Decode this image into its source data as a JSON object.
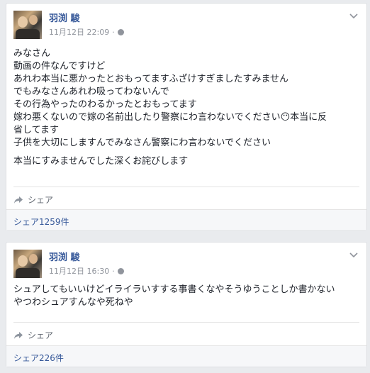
{
  "posts": [
    {
      "author": "羽渕 駿",
      "timestamp": "11月12日 22:09",
      "visibility_sep": "·",
      "body_lines": [
        "みなさん",
        "動画の件なんですけど",
        "あれわ本当に悪かったとおもってますふざけすぎましたすみません",
        "でもみなさんあれわ吸ってわないんで",
        "その行為やったのわるかったとおもってます",
        "嫁わ悪くないので嫁の名前出したり警察にわ言わないでください😶本当に反",
        "省してます",
        "子供を大切にしますんでみなさん警察にわ言わないでください"
      ],
      "body_tail": "本当にすみませんでした深くお詫びします",
      "share_label": "シェア",
      "share_count": "シェア1259件"
    },
    {
      "author": "羽渕 駿",
      "timestamp": "11月12日 16:30",
      "visibility_sep": "·",
      "body_lines": [
        "シュアしてもいいけどイライラいすする事書くなやそうゆうことしか書かない",
        "やつわシュアすんなや死ねや"
      ],
      "share_label": "シェア",
      "share_count": "シェア226件"
    }
  ],
  "icons": {
    "avatar": "profile-photo",
    "globe": "globe-icon",
    "chevron": "chevron-down-icon",
    "share": "share-arrow-icon"
  },
  "colors": {
    "link": "#365899",
    "meta": "#90949c",
    "background": "#e9ebee"
  }
}
